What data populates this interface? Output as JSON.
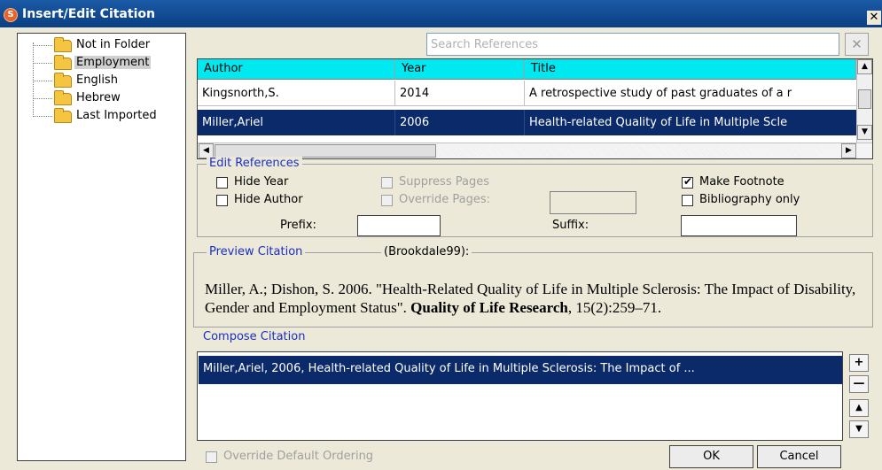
{
  "window": {
    "title": "Insert/Edit Citation"
  },
  "tree": {
    "items": [
      {
        "label": "Not in Folder",
        "icon": "folder-closed-icon",
        "selected": false
      },
      {
        "label": "Employment",
        "icon": "folder-open-icon",
        "selected": true
      },
      {
        "label": "English",
        "icon": "folder-closed-icon",
        "selected": false
      },
      {
        "label": "Hebrew",
        "icon": "folder-closed-icon",
        "selected": false
      },
      {
        "label": "Last Imported",
        "icon": "folder-closed-icon",
        "selected": false
      }
    ]
  },
  "search": {
    "placeholder": "Search References",
    "value": "",
    "clear_label": "✕"
  },
  "references": {
    "columns": [
      "Author",
      "Year",
      "Title"
    ],
    "rows": [
      {
        "author": "Kingsnorth,S.",
        "year": "2014",
        "title": "A retrospective study of past graduates of a r",
        "selected": false
      },
      {
        "author": "Miller,Ariel",
        "year": "2006",
        "title": "Health-related Quality of Life in Multiple Scle",
        "selected": true
      }
    ]
  },
  "edit_references": {
    "title": "Edit References",
    "hide_year": {
      "label": "Hide Year",
      "checked": false
    },
    "hide_author": {
      "label": "Hide Author",
      "checked": false
    },
    "suppress_pages": {
      "label": "Suppress Pages",
      "checked": false,
      "enabled": false
    },
    "override_pages": {
      "label": "Override Pages:",
      "checked": false,
      "enabled": false
    },
    "make_footnote": {
      "label": "Make Footnote",
      "checked": true
    },
    "bibliography_only": {
      "label": "Bibliography only",
      "checked": false
    },
    "prefix_label": "Prefix:",
    "prefix_value": "",
    "suffix_label": "Suffix:",
    "suffix_value": ""
  },
  "preview": {
    "title": "Preview Citation",
    "style": "(Brookdale99):",
    "text_plain": "Miller, A.; Dishon, S. 2006.   \"Health-Related Quality of Life in Multiple Sclerosis: The Impact of Disability, Gender and Employment Status\".",
    "text_bold": "Quality of Life Research",
    "text_tail": ", 15(2):259–71."
  },
  "compose": {
    "title": "Compose Citation",
    "items": [
      "Miller,Ariel, 2006, Health-related Quality of Life in Multiple Sclerosis: The Impact of ..."
    ],
    "add_label": "+",
    "remove_label": "—",
    "up_label": "▲",
    "down_label": "▼"
  },
  "footer": {
    "override_ordering": {
      "label": "Override Default Ordering",
      "checked": false,
      "enabled": false
    },
    "ok_label": "OK",
    "cancel_label": "Cancel"
  },
  "colors": {
    "title_bar": "#0a3f82",
    "header_cyan": "#00e8f0",
    "selection": "#0a2a6a",
    "group_title": "#1a2fc2"
  }
}
